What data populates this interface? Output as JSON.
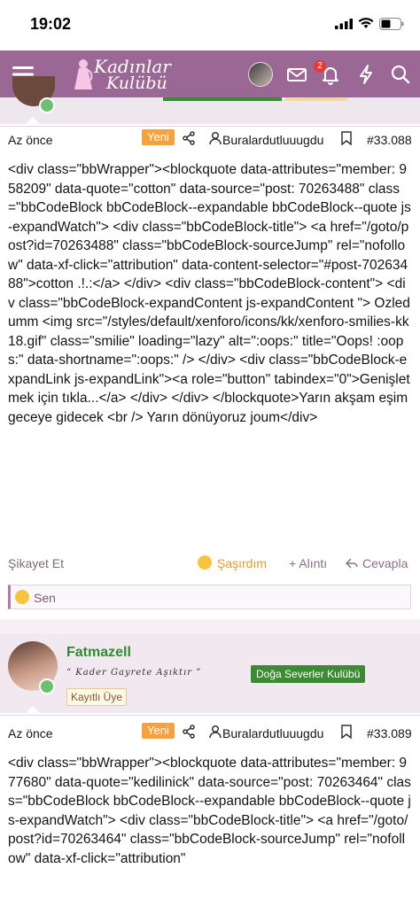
{
  "status_bar": {
    "time": "19:02"
  },
  "header": {
    "logo_line1": "Kadınlar",
    "logo_line2": "Kulübü",
    "alerts_count": "2",
    "icons": [
      "menu-icon",
      "avatar",
      "mail-icon",
      "bell-icon",
      "bolt-icon",
      "search-icon"
    ]
  },
  "posts": [
    {
      "time_ago": "Az önce",
      "new_label": "Yeni",
      "author_link": "Buralardutluuugdu",
      "post_number": "#33.088",
      "body": "<div class=\"bbWrapper\"><blockquote data-attributes=\"member: 958209\" data-quote=\"cotton\" data-source=\"post: 70263488\" class=\"bbCodeBlock bbCodeBlock--expandable bbCodeBlock--quote js-expandWatch\"> <div class=\"bbCodeBlock-title\"> <a href=\"/goto/post?id=70263488\" class=\"bbCodeBlock-sourceJump\" rel=\"nofollow\" data-xf-click=\"attribution\" data-content-selector=\"#post-70263488\">cotton .!.:</a> </div> <div class=\"bbCodeBlock-content\"> <div class=\"bbCodeBlock-expandContent js-expandContent \"> Ozledumm <img src=\"/styles/default/xenforo/icons/kk/xenforo-smilies-kk18.gif\" class=\"smilie\" loading=\"lazy\" alt=\":oops:\" title=\"Oops! :oops:\" data-shortname=\":oops:\" /> </div> <div class=\"bbCodeBlock-expandLink js-expandLink\"><a role=\"button\" tabindex=\"0\">Genişletmek için tıkla...</a> </div> </div> </blockquote>Yarın akşam eşim geceye gidecek <br /> Yarın dönüyoruz joum</div>",
      "actions": {
        "report": "Şikayet Et",
        "reaction": "Şaşırdım",
        "quote": "+ Alıntı",
        "reply": "Cevapla"
      },
      "reactions_by": "Sen"
    },
    {
      "username": "Fatmazell",
      "slogan": "“ 𝐾𝑎𝑑𝑒𝑟 𝐺𝑎𝑦𝑟𝑒𝑡𝑒 𝐴ş𝚤𝑘𝑡𝚤𝑟 ”",
      "group_badge": "Doğa Severler Kulübü",
      "role": "Kayıtlı Üye",
      "time_ago": "Az önce",
      "new_label": "Yeni",
      "author_link": "Buralardutluuugdu",
      "post_number": "#33.089",
      "body": "<div class=\"bbWrapper\"><blockquote data-attributes=\"member: 977680\" data-quote=\"kedilinick\" data-source=\"post: 70263464\" class=\"bbCodeBlock bbCodeBlock--expandable bbCodeBlock--quote js-expandWatch\"> <div class=\"bbCodeBlock-title\"> <a href=\"/goto/post?id=70263464\" class=\"bbCodeBlock-sourceJump\" rel=\"nofollow\" data-xf-click=\"attribution\""
    }
  ]
}
